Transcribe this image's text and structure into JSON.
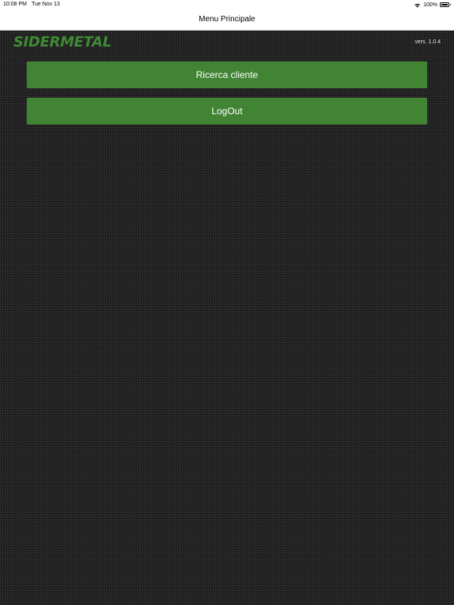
{
  "status_bar": {
    "time": "10:08 PM",
    "date": "Tue Nov 13",
    "battery": "100%",
    "wifi_icon": "wifi-icon",
    "battery_icon": "battery-icon"
  },
  "nav": {
    "title": "Menu Principale"
  },
  "header": {
    "logo": "SIDERMETAL",
    "version": "vers. 1.0.4"
  },
  "menu": {
    "buttons": [
      {
        "label": "Ricerca cliente"
      },
      {
        "label": "LogOut"
      }
    ]
  },
  "colors": {
    "brand_green": "#418434",
    "background": "#1c1c1c"
  }
}
